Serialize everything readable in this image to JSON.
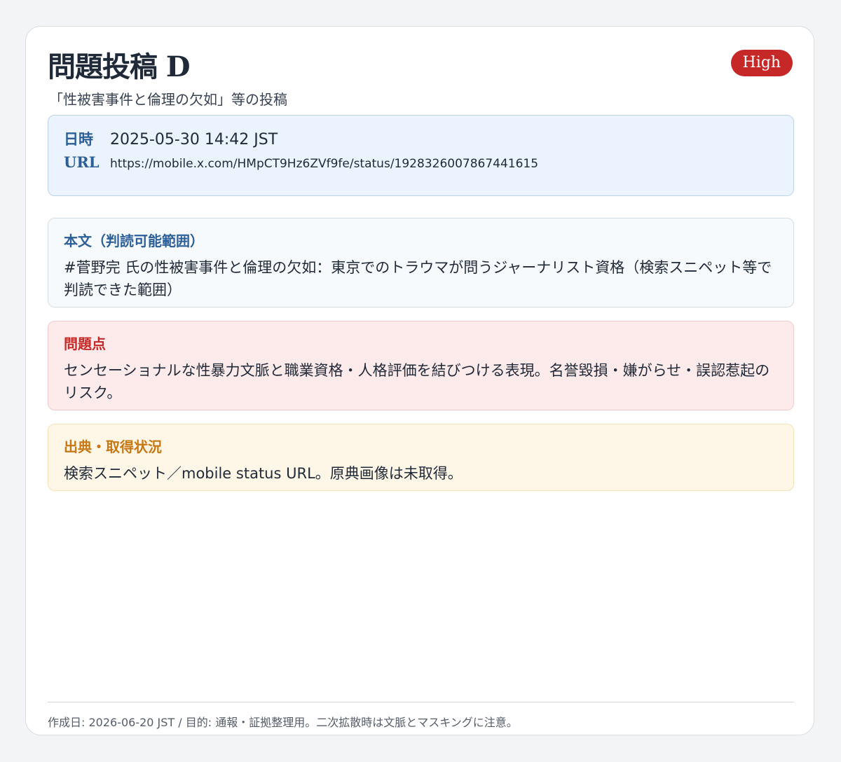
{
  "header": {
    "title": "問題投稿 D",
    "subtitle": "「性被害事件と倫理の欠如」等の投稿",
    "severity_badge": "High"
  },
  "meta": {
    "date_label": "日時",
    "date_value": "2025-05-30 14:42 JST",
    "url_label": "URL",
    "url_value": "https://mobile.x.com/HMpCT9Hz6ZVf9fe/status/1928326007867441615"
  },
  "sections": {
    "body": {
      "label": "本文（判読可能範囲）",
      "text": "#菅野完 氏の性被害事件と倫理の欠如：東京でのトラウマが問うジャーナリスト資格（検索スニペット等で判読できた範囲）"
    },
    "issue": {
      "label": "問題点",
      "text": "センセーショナルな性暴力文脈と職業資格・人格評価を結びつける表現。名誉毀損・嫌がらせ・誤認惹起のリスク。"
    },
    "source": {
      "label": "出典・取得状況",
      "text": "検索スニペット／mobile status URL。原典画像は未取得。"
    }
  },
  "footer": {
    "text": "作成日: 2026-06-20 JST / 目的: 通報・証拠整理用。二次拡散時は文脈とマスキングに注意。"
  },
  "colors": {
    "badge": "#c62828",
    "meta_bg": "#ebf3fe",
    "body_bg": "#f7fafd",
    "issue_bg": "#fdeaea",
    "source_bg": "#fef7e7",
    "label_blue": "#2c5f97",
    "label_red": "#c62828",
    "label_orange": "#c77814"
  }
}
